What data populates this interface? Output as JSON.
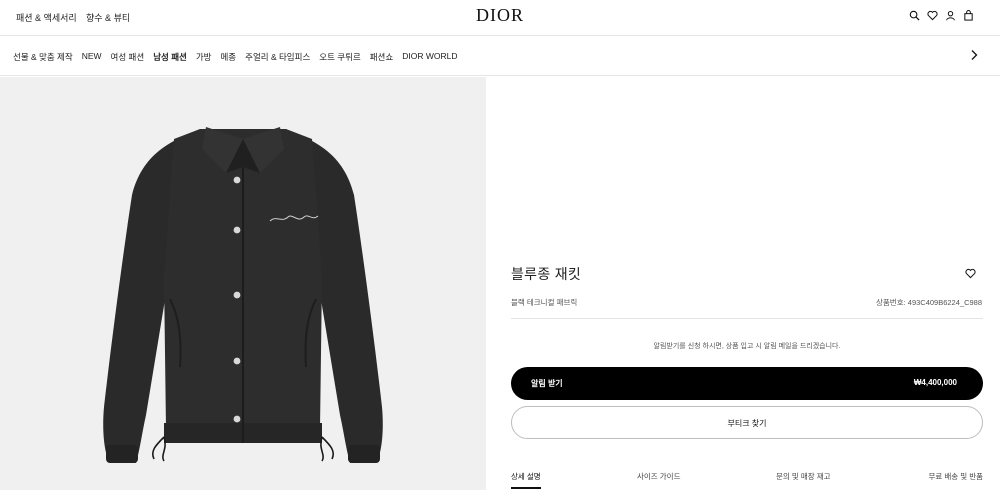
{
  "topbar": {
    "links": [
      "패션 & 액세서리",
      "향수 & 뷰티"
    ],
    "logo": "DIOR",
    "icons": [
      "search-icon",
      "heart-icon",
      "user-icon",
      "bag-icon"
    ]
  },
  "nav": {
    "items": [
      "선물 & 맞춤 제작",
      "NEW",
      "여성 패션",
      "남성 패션",
      "가방",
      "메종",
      "주얼리 & 타임피스",
      "오트 쿠튀르",
      "패션쇼",
      "DIOR WORLD"
    ],
    "active": "남성 패션"
  },
  "product": {
    "title": "블루종 재킷",
    "subtitle": "블랙 테크니컬 패브릭",
    "sku": "상품번호: 493C409B6224_C988",
    "notice": "알림받기를 신청 하시면, 상품 입고 시 알림 메일을 드리겠습니다.",
    "primary_label": "알림 받기",
    "price": "₩4,400,000",
    "secondary_label": "부티크 찾기"
  },
  "tabs": [
    "상세 설명",
    "사이즈 가이드",
    "문의 및 매장 재고",
    "무료 배송 및 반품"
  ],
  "colors": {
    "accent": "#000000",
    "image_bg": "#f0f0f0",
    "jacket": "#2b2b2b"
  }
}
